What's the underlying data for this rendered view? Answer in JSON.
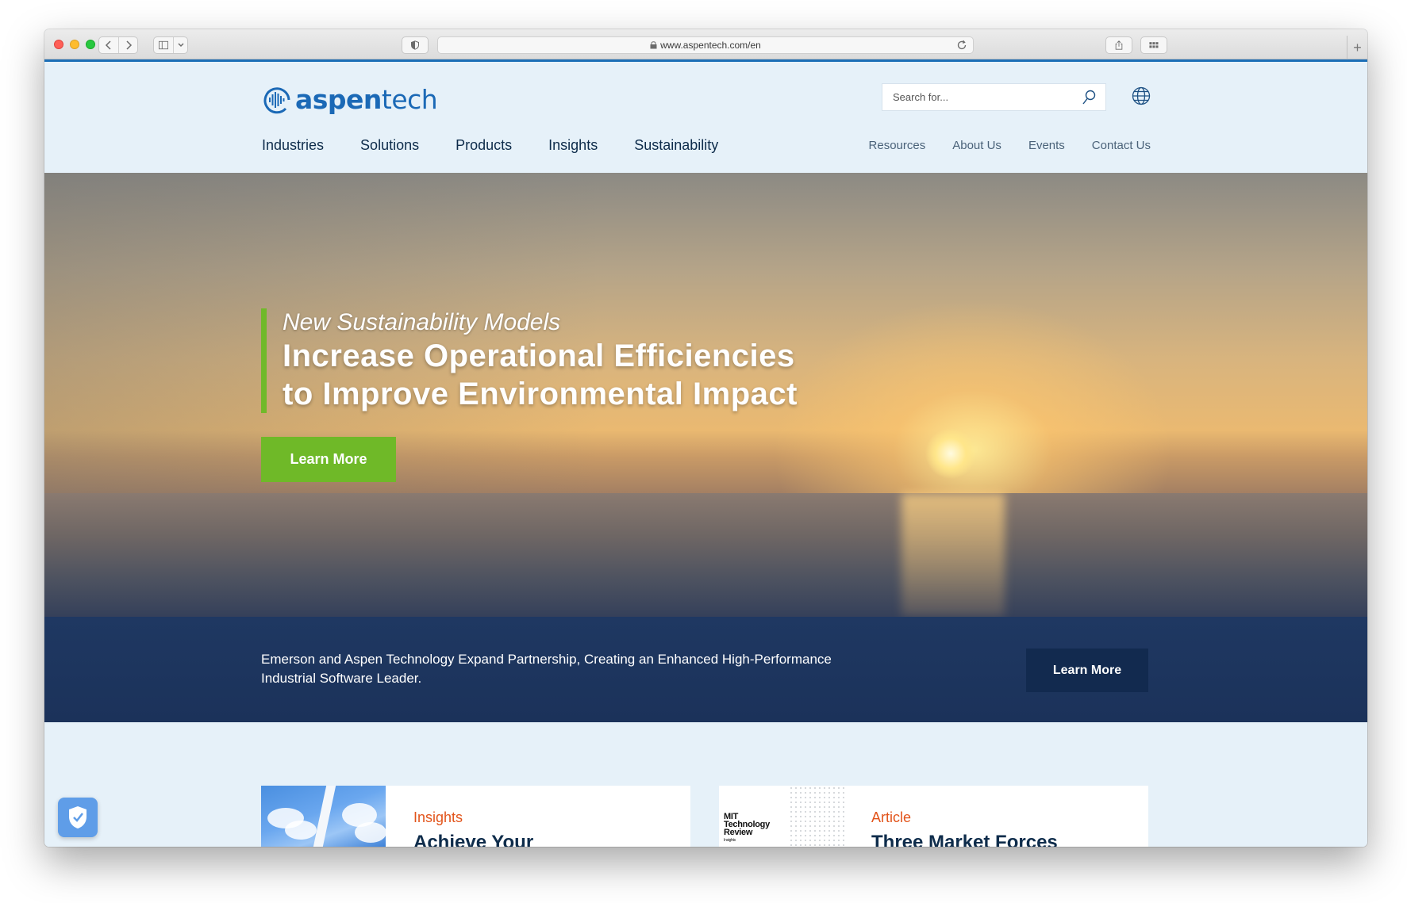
{
  "browser": {
    "url": "www.aspentech.com/en"
  },
  "header": {
    "logo_text_bold": "aspen",
    "logo_text_light": "tech",
    "search_placeholder": "Search for...",
    "main_nav": [
      "Industries",
      "Solutions",
      "Products",
      "Insights",
      "Sustainability"
    ],
    "utility_nav": [
      "Resources",
      "About Us",
      "Events",
      "Contact Us"
    ]
  },
  "hero": {
    "kicker": "New Sustainability Models",
    "title_line1": "Increase Operational Efficiencies",
    "title_line2": "to Improve Environmental Impact",
    "cta_label": "Learn More"
  },
  "banner": {
    "text": "Emerson and Aspen Technology Expand Partnership, Creating an Enhanced High-Performance Industrial Software Leader.",
    "cta_label": "Learn More"
  },
  "cards": [
    {
      "category": "Insights",
      "title": "Achieve Your"
    },
    {
      "category": "Article",
      "title": "Three Market Forces",
      "image_text": [
        "MIT",
        "Technology",
        "Review",
        "Insights"
      ]
    }
  ],
  "colors": {
    "brand_blue": "#1b69b6",
    "accent_green": "#6fb928",
    "navy": "#1f3862",
    "category_orange": "#e2541b"
  }
}
